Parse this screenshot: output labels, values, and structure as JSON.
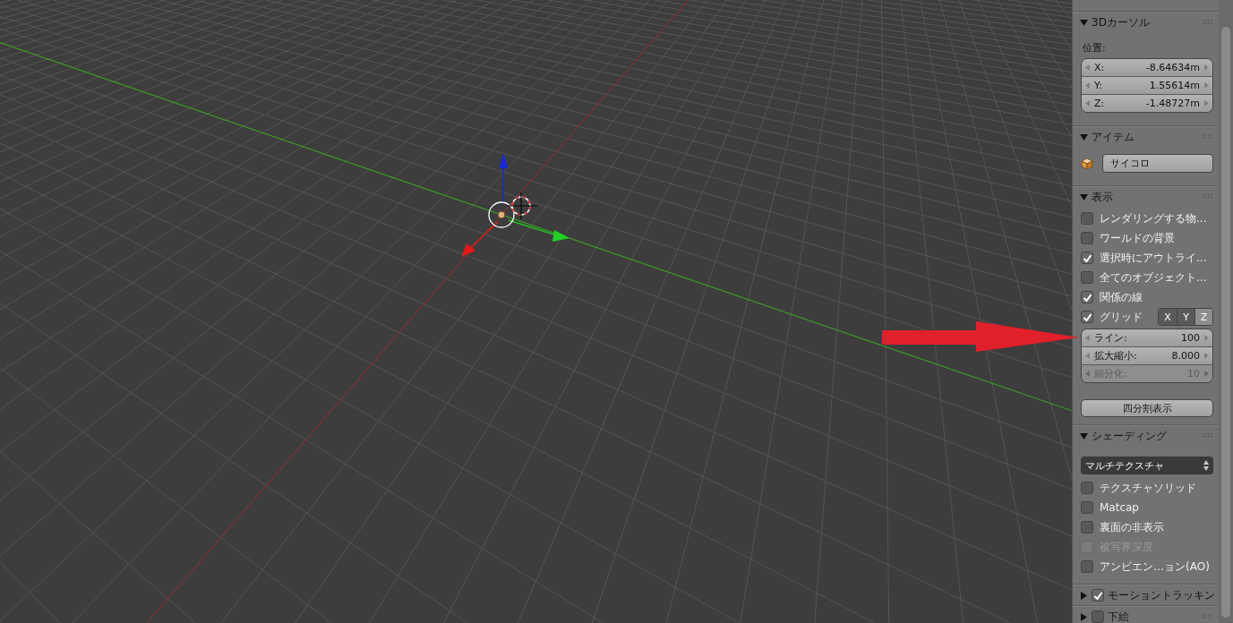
{
  "annotation": {
    "kind": "arrow"
  },
  "panels": [
    {
      "title": "3Dカーソル",
      "expanded": true,
      "rows": [
        {
          "kind": "label",
          "text": "位置:"
        },
        {
          "kind": "vector",
          "fields": [
            {
              "label": "X:",
              "value": "-8.64634m"
            },
            {
              "label": "Y:",
              "value": "1.55614m"
            },
            {
              "label": "Z:",
              "value": "-1.48727m"
            }
          ]
        }
      ]
    },
    {
      "title": "アイテム",
      "expanded": true,
      "rows": [
        {
          "kind": "name",
          "value": "サイコロ"
        }
      ]
    },
    {
      "title": "表示",
      "expanded": true,
      "rows": [
        {
          "kind": "check",
          "label": "レンダリングする物...",
          "checked": false,
          "disabled": false
        },
        {
          "kind": "check",
          "label": "ワールドの背景",
          "checked": false,
          "disabled": false
        },
        {
          "kind": "check",
          "label": "選択時にアウトライ...",
          "checked": true,
          "disabled": false
        },
        {
          "kind": "check",
          "label": "全てのオブジェクト...",
          "checked": false,
          "disabled": false
        },
        {
          "kind": "check",
          "label": "関係の線",
          "checked": true,
          "disabled": false
        },
        {
          "kind": "check_axes",
          "label": "グリッド",
          "checked": true,
          "axes": [
            {
              "label": "X",
              "selected": true
            },
            {
              "label": "Y",
              "selected": true
            },
            {
              "label": "Z",
              "selected": false
            }
          ]
        },
        {
          "kind": "vector",
          "fields": [
            {
              "label": "ライン:",
              "value": "100",
              "disabled": false
            },
            {
              "label": "拡大縮小:",
              "value": "8.000",
              "disabled": false
            },
            {
              "label": "細分化:",
              "value": "10",
              "disabled": true
            }
          ]
        },
        {
          "kind": "button",
          "label": "四分割表示"
        }
      ]
    },
    {
      "title": "シェーディング",
      "expanded": true,
      "rows": [
        {
          "kind": "dropdown",
          "value": "マルチテクスチャ"
        },
        {
          "kind": "check",
          "label": "テクスチャソリッド",
          "checked": false,
          "disabled": false
        },
        {
          "kind": "check",
          "label": "Matcap",
          "checked": false,
          "disabled": false
        },
        {
          "kind": "check",
          "label": "裏面の非表示",
          "checked": false,
          "disabled": false
        },
        {
          "kind": "check",
          "label": "被写界深度",
          "checked": false,
          "disabled": true
        },
        {
          "kind": "check",
          "label": "アンビエン…ョン(AO)",
          "checked": false,
          "disabled": false
        }
      ]
    },
    {
      "title": "モーショントラッキン",
      "expanded": false,
      "checked": true
    },
    {
      "title": "下絵",
      "expanded": false,
      "checked": false
    }
  ]
}
